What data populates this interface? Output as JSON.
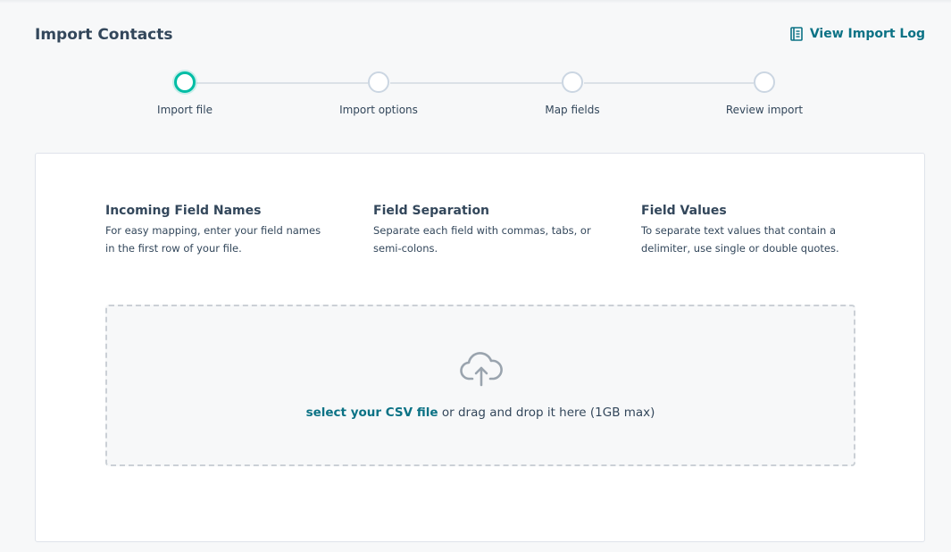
{
  "header": {
    "title": "Import Contacts",
    "view_log_label": "View Import Log"
  },
  "stepper": {
    "steps": [
      {
        "label": "Import file",
        "active": true
      },
      {
        "label": "Import options",
        "active": false
      },
      {
        "label": "Map fields",
        "active": false
      },
      {
        "label": "Review import",
        "active": false
      }
    ]
  },
  "info": [
    {
      "title": "Incoming Field Names",
      "text": "For easy mapping, enter your field names in the first row of your file."
    },
    {
      "title": "Field Separation",
      "text": "Separate each field with commas, tabs, or semi-colons."
    },
    {
      "title": "Field Values",
      "text": "To separate text values that contain a delimiter, use single or double quotes."
    }
  ],
  "dropzone": {
    "icon": "cloud-upload-icon",
    "select_link": "select your CSV file",
    "rest_text": " or drag and drop it here (1GB max)"
  },
  "colors": {
    "accent": "#0b7285",
    "active_step": "#00bda5"
  }
}
